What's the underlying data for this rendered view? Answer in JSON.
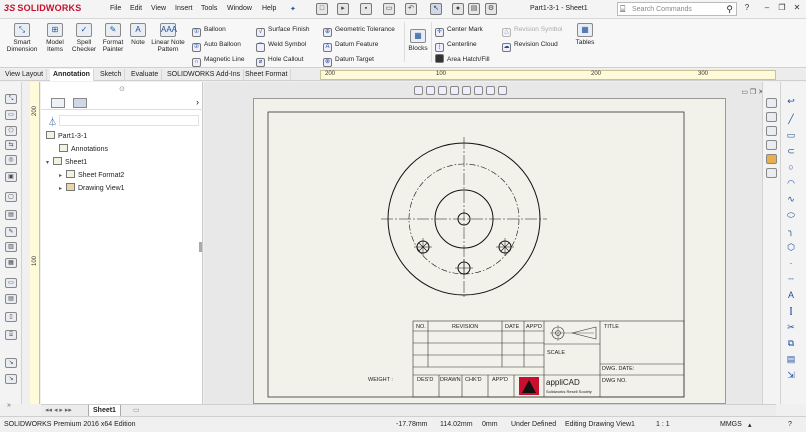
{
  "app": {
    "logo": "SOLIDWORKS",
    "doc_title": "Part1-3-1 - Sheet1"
  },
  "menu": [
    "File",
    "Edit",
    "View",
    "Insert",
    "Tools",
    "Window",
    "Help"
  ],
  "search": {
    "placeholder": "Search Commands"
  },
  "ribbon": {
    "big": [
      "Smart Dimension",
      "Model Items",
      "Spell Checker",
      "Format Painter",
      "Note",
      "Linear Note Pattern"
    ],
    "col1": [
      "Balloon",
      "Auto Balloon",
      "Magnetic Line"
    ],
    "col2": [
      "Surface Finish",
      "Weld Symbol",
      "Hole Callout"
    ],
    "col3": [
      "Geometric Tolerance",
      "Datum Feature",
      "Datum Target"
    ],
    "blocks": "Blocks",
    "col4": [
      "Center Mark",
      "Centerline",
      "Area Hatch/Fill"
    ],
    "col5": [
      "Revision Symbol",
      "Revision Cloud"
    ],
    "tables": "Tables"
  },
  "tabs": [
    "View Layout",
    "Annotation",
    "Sketch",
    "Evaluate",
    "SOLIDWORKS Add-Ins",
    "Sheet Format"
  ],
  "active_tab": "Annotation",
  "ruler_h": [
    "200",
    "100",
    "200",
    "300"
  ],
  "ruler_v": [
    "200",
    "100"
  ],
  "tree": {
    "root": "Part1-3-1",
    "annotations": "Annotations",
    "sheet": "Sheet1",
    "sheet_format": "Sheet Format2",
    "drawing_view": "Drawing View1"
  },
  "title_block": {
    "rev_headers": [
      "NO.",
      "REVISION",
      "DATE",
      "APP'D"
    ],
    "title_label": "TITLE",
    "scale_label": "SCALE",
    "dwg_date": "DWG. DATE:",
    "dwg_no": "DWG NO.",
    "weight": "WEIGHT :",
    "signers": [
      "DES'D",
      "DRAWN",
      "CHK'D",
      "APP'D"
    ],
    "company": "appliCAD",
    "tagline": "Solidworks Resell Society"
  },
  "sheet_tab": "Sheet1",
  "status": {
    "edition": "SOLIDWORKS Premium 2016 x64 Edition",
    "x": "-17.78mm",
    "y": "114.02mm",
    "z": "0mm",
    "state": "Under Defined",
    "mode": "Editing Drawing View1",
    "scale": "1 : 1",
    "units": "MMGS"
  }
}
